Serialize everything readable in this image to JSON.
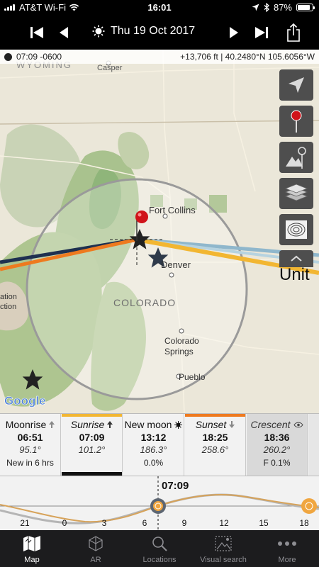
{
  "status": {
    "carrier": "AT&T Wi-Fi",
    "time": "16:01",
    "battery": "87%",
    "battery_level": 0.87
  },
  "nav": {
    "date": "Thu 19 Oct 2017"
  },
  "map": {
    "time_label": "07:09 -0600",
    "coords": "+13,706 ft | 40.2480°N 105.6056°W",
    "labels": {
      "wyoming": "WYOMING",
      "casper": "Casper",
      "fort_collins": "Fort Collins",
      "denver": "Denver",
      "colorado": "COLORADO",
      "colorado_springs_1": "Colorado",
      "colorado_springs_2": "Springs",
      "pueblo": "Pueblo",
      "unit": "Unit",
      "left_partial_1": "ation",
      "left_partial_2": "ction",
      "google": "Google"
    }
  },
  "cards": [
    {
      "title": "Moonrise",
      "time": "06:51",
      "angle": "95.1°",
      "sub": "New in 6 hrs"
    },
    {
      "title": "Sunrise",
      "time": "07:09",
      "angle": "101.2°",
      "sub": ""
    },
    {
      "title": "New moon",
      "time": "13:12",
      "angle": "186.3°",
      "sub": "0.0%"
    },
    {
      "title": "Sunset",
      "time": "18:25",
      "angle": "258.6°",
      "sub": ""
    },
    {
      "title": "Crescent",
      "time": "18:36",
      "angle": "260.2°",
      "sub": "F 0.1%"
    }
  ],
  "timeline": {
    "current_time": "07:09",
    "ticks": [
      "21",
      "0",
      "3",
      "6",
      "9",
      "12",
      "15",
      "18"
    ]
  },
  "tabs": [
    {
      "label": "Map",
      "icon": "map-icon"
    },
    {
      "label": "AR",
      "icon": "cube-icon"
    },
    {
      "label": "Locations",
      "icon": "magnifier-icon"
    },
    {
      "label": "Visual search",
      "icon": "visual-search-icon"
    },
    {
      "label": "More",
      "icon": "more-dots-icon"
    }
  ],
  "colors": {
    "sun_line": "#f2b632",
    "sunrise_orange": "#ee7a1f",
    "moon_line": "#8fb7cc",
    "night_line": "#1e3050",
    "pin_red": "#d0131a",
    "tab_active": "#ffffff",
    "tab_inactive": "#8e8e93"
  }
}
